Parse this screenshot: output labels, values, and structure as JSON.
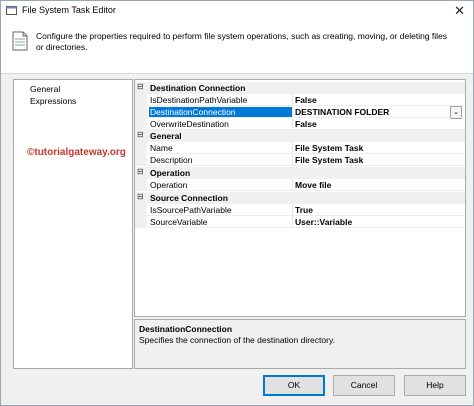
{
  "window": {
    "title": "File System Task Editor",
    "close_glyph": "✕"
  },
  "header": {
    "description": "Configure the properties required to perform file system operations, such as creating, moving, or deleting files or directories."
  },
  "nav": {
    "items": [
      "General",
      "Expressions"
    ]
  },
  "watermark": "©tutorialgateway.org",
  "grid": {
    "categories": [
      {
        "label": "Destination Connection",
        "toggle": "⊟",
        "props": [
          {
            "name": "IsDestinationPathVariable",
            "value": "False"
          },
          {
            "name": "DestinationConnection",
            "value": "DESTINATION FOLDER"
          },
          {
            "name": "OverwriteDestination",
            "value": "False"
          }
        ]
      },
      {
        "label": "General",
        "toggle": "⊟",
        "props": [
          {
            "name": "Name",
            "value": "File System Task"
          },
          {
            "name": "Description",
            "value": "File System Task"
          }
        ]
      },
      {
        "label": "Operation",
        "toggle": "⊟",
        "props": [
          {
            "name": "Operation",
            "value": "Move file"
          }
        ]
      },
      {
        "label": "Source Connection",
        "toggle": "⊟",
        "props": [
          {
            "name": "IsSourcePathVariable",
            "value": "True"
          },
          {
            "name": "SourceVariable",
            "value": "User::Variable"
          }
        ]
      }
    ],
    "dropdown_glyph": "⌄"
  },
  "help": {
    "title": "DestinationConnection",
    "text": "Specifies the connection of the destination directory."
  },
  "buttons": {
    "ok": "OK",
    "cancel": "Cancel",
    "help": "Help"
  }
}
